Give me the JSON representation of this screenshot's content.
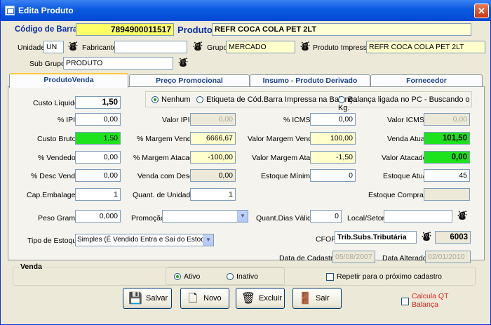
{
  "window": {
    "title": "Edita Produto",
    "close": "✕"
  },
  "header": {
    "barcode_label": "Código de Barra",
    "barcode": "7894900011517",
    "product_label": "Produto",
    "product": "REFR COCA COLA PET 2LT",
    "unit_label": "Unidade",
    "unit": "UN",
    "maker_label": "Fabricante",
    "maker": "",
    "group_label": "Grupo",
    "group": "MERCADO",
    "print_label": "Produto Impressão",
    "print": "REFR COCA COLA PET 2LT",
    "subgroup_label": "Sub Grupo",
    "subgroup": "PRODUTO"
  },
  "tabs": [
    "ProdutoVenda",
    "Preço Promocional",
    "Insumo - Produto Derivado",
    "Fornecedor"
  ],
  "radios": [
    {
      "label": "Nenhum",
      "checked": true
    },
    {
      "label": "Etiqueta de Cód.Barra Impressa na Balança",
      "checked": false
    },
    {
      "label": "Balança ligada no PC - Buscando o Kg.",
      "checked": false
    }
  ],
  "fields": {
    "custo_liquido": {
      "label": "Custo Líquido",
      "value": "1,50"
    },
    "ipi": {
      "label": "% IPI",
      "value": "0,00"
    },
    "valor_ipi": {
      "label": "Valor IPI",
      "value": "0,00"
    },
    "icms": {
      "label": "% ICMS",
      "value": "0,00"
    },
    "valor_icms": {
      "label": "Valor ICMS",
      "value": "0,00"
    },
    "custo_bruto": {
      "label": "Custo Bruto",
      "value": "1,50"
    },
    "margem_venda": {
      "label": "% Margem Venda",
      "value": "6666,67"
    },
    "valor_margem_venda": {
      "label": "Valor Margem Venda",
      "value": "100,00"
    },
    "venda_atual": {
      "label": "Venda Atual",
      "value": "101,50"
    },
    "vendedor": {
      "label": "% Vendedor",
      "value": "0,00"
    },
    "margem_atacado": {
      "label": "% Margem Atacado",
      "value": "-100,00"
    },
    "valor_margem_atac": {
      "label": "Valor Margem Atac",
      "value": "-1,50"
    },
    "valor_atacado": {
      "label": "Valor Atacado",
      "value": "0,00"
    },
    "desc_venda": {
      "label": "% Desc Venda",
      "value": "0,00"
    },
    "venda_com_desc": {
      "label": "Venda com Desc.",
      "value": "0,00"
    },
    "estoque_minimo": {
      "label": "Estoque Mínimo",
      "value": "0"
    },
    "estoque_atual": {
      "label": "Estoque Atual",
      "value": "45"
    },
    "cap_embalagem": {
      "label": "Cap.Embalagem",
      "value": "1"
    },
    "quant_unidade": {
      "label": "Quant. de Unidade",
      "value": "1"
    },
    "estoque_comprado": {
      "label": "Estoque Comprado",
      "value": ""
    },
    "peso_grama": {
      "label": "Peso Grama",
      "value": "0,000"
    },
    "promocao": {
      "label": "Promoção",
      "value": ""
    },
    "quant_dias": {
      "label": "Quant.Dias Válido",
      "value": "0"
    },
    "local_setor": {
      "label": "Local/Setor",
      "value": ""
    },
    "tipo_estoque": {
      "label": "Tipo de Estoque",
      "value": "Simples (É Vendido Entra e Sai do Estoque)"
    },
    "cfop": {
      "label": "CFOP",
      "value": "Trib.Subs.Tributária",
      "code": "6003"
    },
    "data_cadastro": {
      "label": "Data de Cadastro",
      "value": "05/08/2007"
    },
    "data_alterado": {
      "label": "Data Alterado",
      "value": "02/01/2010"
    }
  },
  "venda": {
    "title": "Venda",
    "ativo": "Ativo",
    "inativo": "Inativo",
    "repetir": "Repetir para o próximo cadastro"
  },
  "buttons": {
    "salvar": "Salvar",
    "novo": "Novo",
    "excluir": "Excluir",
    "sair": "Sair"
  },
  "calcula": {
    "line1": "Calcula QT",
    "line2": "Balança",
    "color": "#e0201a"
  },
  "colors": {
    "yellow_field": "#ffff66",
    "green_field": "#1de31d",
    "title_blue": "#0a5ae0",
    "label_blue": "#0a2fa0"
  }
}
